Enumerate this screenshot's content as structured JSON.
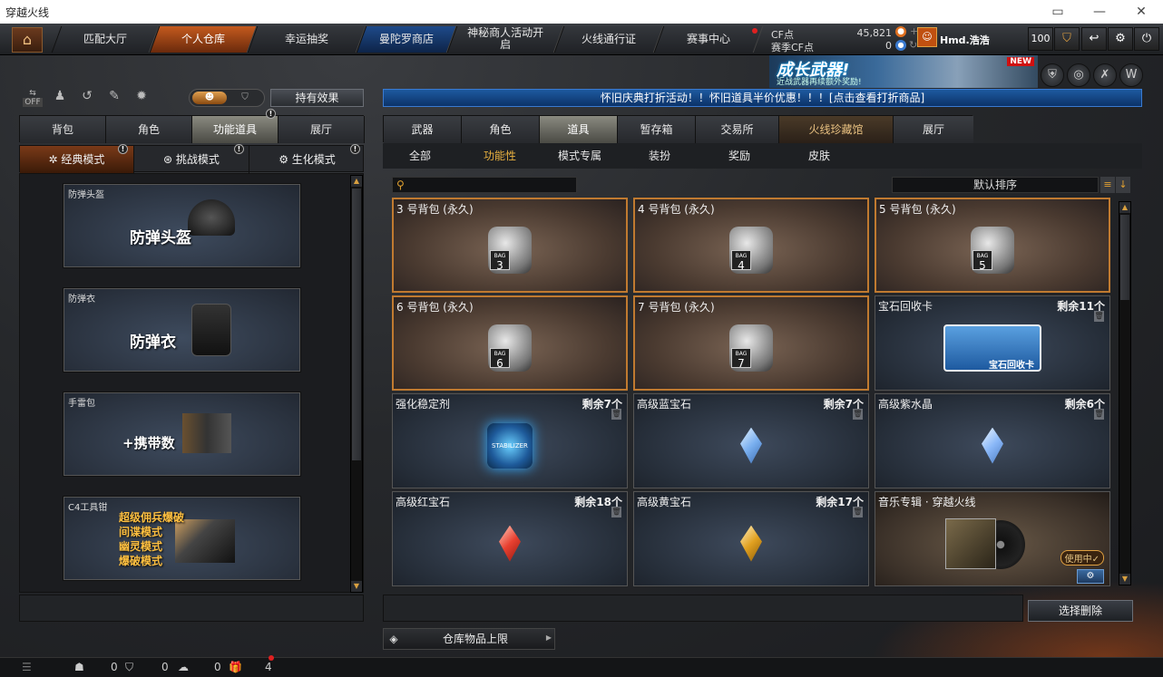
{
  "window": {
    "title": "穿越火线"
  },
  "nav": {
    "tabs": [
      "匹配大厅",
      "个人仓库",
      "幸运抽奖",
      "曼陀罗商店",
      "神秘商人活动开启",
      "火线通行证",
      "赛事中心"
    ],
    "cf_label": "CF点",
    "cf_value": "45,821",
    "scf_label": "赛季CF点",
    "scf_value": "0",
    "username": "Hmd.浩浩",
    "level": "100"
  },
  "banner": {
    "title": "成长武器!",
    "subtitle": "近战武器再续额外奖励!",
    "badge": "NEW"
  },
  "left": {
    "toggle_off": "OFF",
    "effect_button": "持有效果",
    "tabs": [
      "背包",
      "角色",
      "功能道具",
      "展厅"
    ],
    "modes": [
      "经典模式",
      "挑战模式",
      "生化模式"
    ],
    "cards": [
      {
        "label": "防弹头盔",
        "big": "防弹头盔"
      },
      {
        "label": "防弹衣",
        "big": "防弹衣"
      },
      {
        "label": "手雷包",
        "big": "+携带数"
      },
      {
        "label": "C4工具钳",
        "lines": [
          "超级佣兵爆破",
          "间谍模式",
          "幽灵模式",
          "爆破模式"
        ]
      }
    ]
  },
  "right": {
    "notice": "怀旧庆典打折活动！！怀旧道具半价优惠！！！[点击查看打折商品]",
    "tabs": [
      "武器",
      "角色",
      "道具",
      "暂存箱",
      "交易所",
      "火线珍藏馆",
      "展厅"
    ],
    "subtabs": [
      "全部",
      "功能性",
      "模式专属",
      "装扮",
      "奖励",
      "皮肤"
    ],
    "sort_label": "默认排序",
    "items": [
      {
        "name": "3 号背包 (永久)",
        "bag": "3"
      },
      {
        "name": "4 号背包 (永久)",
        "bag": "4"
      },
      {
        "name": "5 号背包 (永久)",
        "bag": "5"
      },
      {
        "name": "6 号背包 (永久)",
        "bag": "6"
      },
      {
        "name": "7 号背包 (永久)",
        "bag": "7"
      },
      {
        "name": "宝石回收卡",
        "remain": "剩余11个",
        "card_text": "宝石回收卡"
      },
      {
        "name": "强化稳定剂",
        "remain": "剩余7个",
        "stab_text": "STABILIZER"
      },
      {
        "name": "高级蓝宝石",
        "remain": "剩余7个",
        "gem": "#7ab0f0"
      },
      {
        "name": "高级紫水晶",
        "remain": "剩余6个",
        "gem": "#8ab8f8"
      },
      {
        "name": "高级红宝石",
        "remain": "剩余18个",
        "gem": "#e84030"
      },
      {
        "name": "高级黄宝石",
        "remain": "剩余17个",
        "gem": "#e0a020"
      },
      {
        "name": "音乐专辑 · 穿越火线",
        "in_use": "使用中✓"
      }
    ],
    "delete_button": "选择删除",
    "capacity_label": "仓库物品上限"
  },
  "bottom": {
    "count1": "0",
    "count2": "0",
    "count3": "0",
    "count4": "4"
  },
  "colors": {
    "accent": "#c45a1e",
    "notice": "#1e5aa0"
  }
}
